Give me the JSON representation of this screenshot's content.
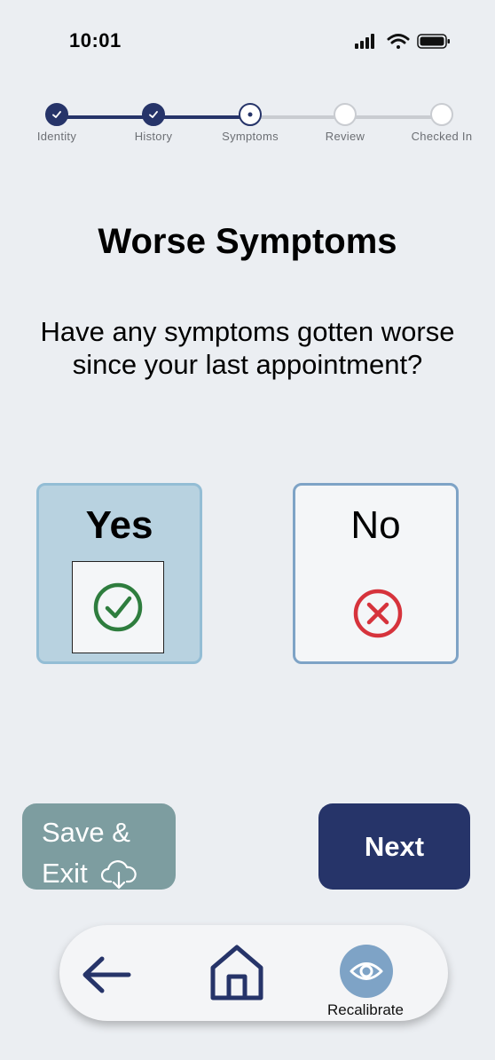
{
  "status_bar": {
    "time": "10:01",
    "icons": [
      "signal-icon",
      "wifi-icon",
      "battery-icon"
    ]
  },
  "stepper": {
    "steps": [
      {
        "label": "Identity",
        "state": "done"
      },
      {
        "label": "History",
        "state": "done"
      },
      {
        "label": "Symptoms",
        "state": "current"
      },
      {
        "label": "Review",
        "state": "todo"
      },
      {
        "label": "Checked In",
        "state": "todo"
      }
    ]
  },
  "page": {
    "title": "Worse Symptoms",
    "question": "Have any symptoms gotten worse since your last appointment?"
  },
  "choices": {
    "yes": {
      "label": "Yes",
      "selected": true,
      "icon": "check-circle-icon"
    },
    "no": {
      "label": "No",
      "selected": false,
      "icon": "x-circle-icon"
    }
  },
  "actions": {
    "save_line1": "Save &",
    "save_line2": "Exit",
    "save_icon": "cloud-download-icon",
    "next_label": "Next"
  },
  "nav": {
    "back_icon": "arrow-left-icon",
    "home_icon": "home-icon",
    "recalibrate_icon": "eye-icon",
    "recalibrate_label": "Recalibrate"
  },
  "colors": {
    "background": "#ebeef2",
    "primary": "#263469",
    "selected_fill": "#b8d2e0",
    "accent_blue": "#7ea3c6",
    "save_button": "#7d9da0",
    "check_green": "#2e7d3e",
    "x_red": "#d6333c"
  }
}
